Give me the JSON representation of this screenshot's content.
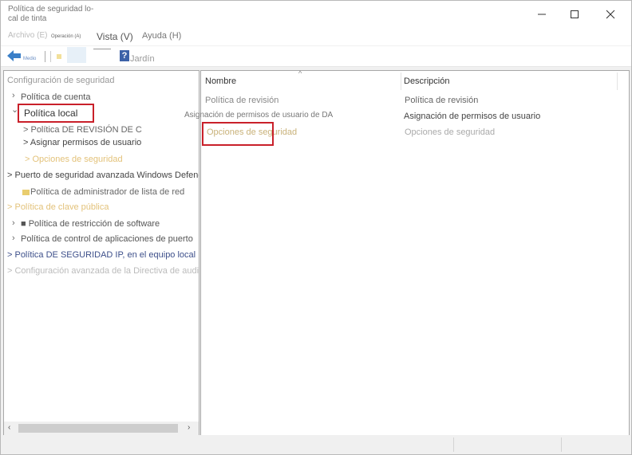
{
  "window": {
    "title": "Política de seguridad lo-\ncal de tinta",
    "controls": {
      "minimize": "—",
      "maximize": "☐",
      "close": "✕"
    }
  },
  "menu": {
    "archivo": "Archivo (E)",
    "operacion": "Operación (A)",
    "vista": "Vista (V)",
    "ayuda": "Ayuda (H)"
  },
  "toolbar": {
    "medio": "Medio",
    "help_glyph": "?",
    "help_label": "Jardín"
  },
  "tree": {
    "root": "Configuración de seguridad",
    "items": [
      {
        "label": "Política de cuenta",
        "chevron": "›"
      },
      {
        "label": "Política local",
        "chevron": "⌄"
      },
      {
        "label": "> Política DE REVISIÓN DE C"
      },
      {
        "label": "> Asignar permisos de usuario"
      },
      {
        "label": "> Opciones de seguridad"
      },
      {
        "label": "> Puerto de seguridad avanzada Windows Defender prevención de incendios"
      },
      {
        "label": "Política de administrador de lista de red"
      },
      {
        "label": "> Política de clave pública"
      },
      {
        "label": "■ Política de restricción de software",
        "chevron": "›"
      },
      {
        "label": "Política de control de aplicaciones de puerto",
        "chevron": "›"
      },
      {
        "label": "> Política DE SEGURIDAD IP, en el equipo local"
      },
      {
        "label": "> Configuración avanzada de la Directiva de auditoría"
      }
    ]
  },
  "scrollbar": {
    "left": "‹",
    "right": "›"
  },
  "list": {
    "columns": {
      "name": "Nombre",
      "description": "Descripción",
      "sort": "^"
    },
    "rows": [
      {
        "name": "Política de revisión",
        "description": "Política de revisión"
      },
      {
        "name": "Asignación de permisos de usuario de DA",
        "description": "Asignación de permisos de usuario"
      },
      {
        "name": "Opciones de seguridad",
        "description": "Opciones de seguridad"
      }
    ]
  },
  "colors": {
    "highlight_box": "#c9202a",
    "muted_text": "#bbbbbb",
    "link_blue": "#3d4f8a"
  }
}
